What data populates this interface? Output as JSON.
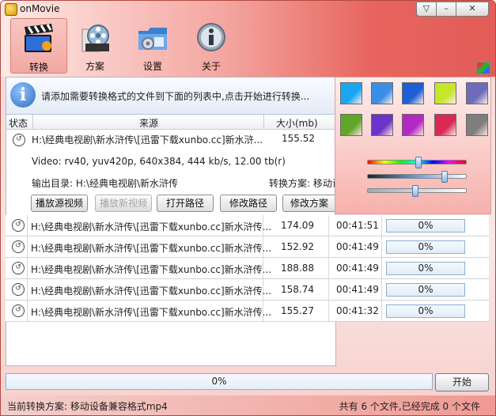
{
  "app": {
    "title": "onMovie"
  },
  "window_buttons": [
    "▽",
    "–",
    "✕"
  ],
  "toolbar": [
    {
      "label": "转换",
      "icon": "film-clapper-icon",
      "active": true
    },
    {
      "label": "方案",
      "icon": "film-reel-icon",
      "active": false
    },
    {
      "label": "设置",
      "icon": "settings-folder-icon",
      "active": false
    },
    {
      "label": "关于",
      "icon": "info-icon",
      "active": false
    }
  ],
  "hint": "请添加需要转换格式的文件到下面的列表中,点击开始进行转换...",
  "table": {
    "headers": {
      "status": "状态",
      "source": "来源",
      "size": "大小(mb)"
    }
  },
  "expanded": {
    "path": "H:\\经典电视剧\\新水浒传\\[迅雷下载xunbo.cc]新水浒...",
    "size": "155.52",
    "video_info": "Video: rv40, yuv420p, 640x384, 444 kb/s, 12.00 tb(r)",
    "output_dir": "输出目录: H:\\经典电视剧\\新水浒传",
    "scheme": "转换方案: 移动设",
    "buttons": {
      "play_source": "播放源视频",
      "play_new": "播放新视频",
      "open_path": "打开路径",
      "modify_path": "修改路径",
      "modify_scheme": "修改方案"
    }
  },
  "rows": [
    {
      "path": "H:\\经典电视剧\\新水浒传\\[迅雷下载xunbo.cc]新水浒传...",
      "size": "174.09",
      "time": "00:41:51",
      "progress": "0%"
    },
    {
      "path": "H:\\经典电视剧\\新水浒传\\[迅雷下载xunbo.cc]新水浒传...",
      "size": "152.92",
      "time": "00:41:49",
      "progress": "0%"
    },
    {
      "path": "H:\\经典电视剧\\新水浒传\\[迅雷下载xunbo.cc]新水浒传...",
      "size": "188.88",
      "time": "00:41:49",
      "progress": "0%"
    },
    {
      "path": "H:\\经典电视剧\\新水浒传\\[迅雷下载xunbo.cc]新水浒传...",
      "size": "158.74",
      "time": "00:41:49",
      "progress": "0%"
    },
    {
      "path": "H:\\经典电视剧\\新水浒传\\[迅雷下载xunbo.cc]新水浒传...",
      "size": "155.27",
      "time": "00:41:32",
      "progress": "0%"
    }
  ],
  "color_swatches": [
    "#1aa6f0",
    "#3a8ee6",
    "#1f5fd6",
    "#c6e62a",
    "#6f6bbb",
    "#5fa62a",
    "#6a33c9",
    "#b229c4",
    "#d92a54",
    "#7e7e7e"
  ],
  "sliders": [
    0.52,
    0.78,
    0.48
  ],
  "bottom": {
    "progress": "0%",
    "start_label": "开始"
  },
  "status": {
    "left": "当前转换方案: 移动设备兼容格式mp4",
    "right": "共有 6 个文件,已经完成 0 个文件"
  }
}
